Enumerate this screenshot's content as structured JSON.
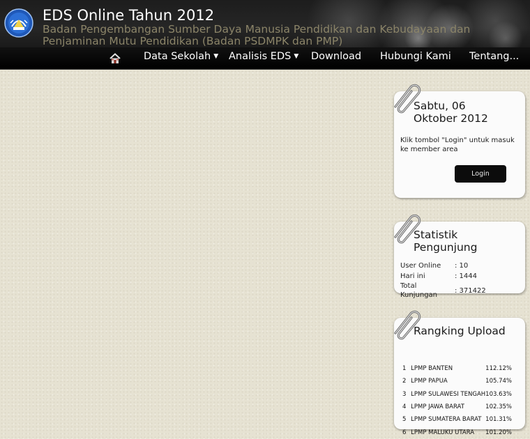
{
  "header": {
    "title": "EDS Online Tahun 2012",
    "subtitle": "Badan Pengembangan Sumber Daya Manusia Pendidikan dan Kebudayaan dan Penjaminan Mutu Pendidikan (Badan PSDMPK dan PMP)",
    "logo_icon": "ministry-logo-icon"
  },
  "nav": {
    "home_icon": "home-icon",
    "items": [
      {
        "label": "Data Sekolah",
        "dropdown": true
      },
      {
        "label": "Analisis EDS",
        "dropdown": true
      },
      {
        "label": "Download",
        "dropdown": false
      },
      {
        "label": "Hubungi Kami",
        "dropdown": false
      },
      {
        "label": "Tentang...",
        "dropdown": false
      }
    ]
  },
  "login_widget": {
    "date_line1": "Sabtu, 06",
    "date_line2": "Oktober 2012",
    "message": "Klik tombol \"Login\" untuk masuk ke member area",
    "button_label": "Login"
  },
  "stats_widget": {
    "title_line1": "Statistik",
    "title_line2": "Pengunjung",
    "rows": [
      {
        "label": "User Online",
        "value": ": 10"
      },
      {
        "label": "Hari ini",
        "value": ": 1444"
      },
      {
        "label": "Total Kunjungan",
        "value": ": 371422"
      }
    ]
  },
  "rank_widget": {
    "title": "Rangking Upload",
    "rows": [
      {
        "rank": "1",
        "name": "LPMP BANTEN",
        "percent": "112.12%"
      },
      {
        "rank": "2",
        "name": "LPMP PAPUA",
        "percent": "105.74%"
      },
      {
        "rank": "3",
        "name": "LPMP SULAWESI TENGAH",
        "percent": "103.63%"
      },
      {
        "rank": "4",
        "name": "LPMP JAWA BARAT",
        "percent": "102.35%"
      },
      {
        "rank": "5",
        "name": "LPMP SUMATERA BARAT",
        "percent": "101.31%"
      },
      {
        "rank": "6",
        "name": "LPMP MALUKU UTARA",
        "percent": "101.20%"
      }
    ]
  },
  "colors": {
    "header_bg": "#222222",
    "subtitle": "#8b8468",
    "page_bg": "#e6e2d2",
    "widget_bg": "#fbfbfb"
  }
}
